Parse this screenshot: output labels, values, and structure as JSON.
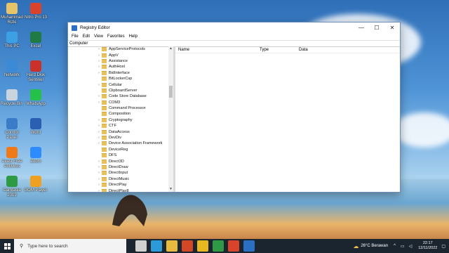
{
  "desktop_icons": [
    {
      "label": "Muhammad Rizki",
      "name": "user-folder-icon",
      "color": "#e6c46a"
    },
    {
      "label": "Nitro Pro 13",
      "name": "nitro-pro-icon",
      "color": "#d9432b"
    },
    {
      "label": "This PC",
      "name": "this-pc-icon",
      "color": "#3ea0e4"
    },
    {
      "label": "Excel",
      "name": "excel-icon",
      "color": "#1f7a43"
    },
    {
      "label": "Network",
      "name": "network-icon",
      "color": "#3a8ad6"
    },
    {
      "label": "Hard Disk Sentinel",
      "name": "hard-disk-sentinel-icon",
      "color": "#c9322a"
    },
    {
      "label": "Recycle Bin",
      "name": "recycle-bin-icon",
      "color": "#c8d4de"
    },
    {
      "label": "WhatsApp",
      "name": "whatsapp-icon",
      "color": "#25c04a"
    },
    {
      "label": "Control Panel",
      "name": "control-panel-icon",
      "color": "#3a7cc8"
    },
    {
      "label": "Word",
      "name": "word-icon",
      "color": "#2b5fb2"
    },
    {
      "label": "Avast Free Antivirus",
      "name": "avast-icon",
      "color": "#f07a1a"
    },
    {
      "label": "Zoom",
      "name": "zoom-icon",
      "color": "#2d8cff"
    },
    {
      "label": "Camtasia 2019",
      "name": "camtasia-icon",
      "color": "#2f9a45"
    },
    {
      "label": "GOM Player",
      "name": "gom-player-icon",
      "color": "#f0a020"
    }
  ],
  "window": {
    "title": "Registry Editor",
    "minimize": "—",
    "maximize": "☐",
    "close": "✕",
    "menu": [
      "File",
      "Edit",
      "View",
      "Favorites",
      "Help"
    ],
    "address": "Computer"
  },
  "tree": {
    "items": [
      "AppServiceProtocols",
      "AppV",
      "Assistance",
      "AuthHost",
      "BidInterface",
      "BitLockerCsp",
      "Cellular",
      "ClipboardServer",
      "Code Store Database",
      "COM3",
      "Command Processor",
      "Composition",
      "Cryptography",
      "CTF",
      "DataAccess",
      "DevDiv",
      "Device Association Framework",
      "DeviceReg",
      "DFS",
      "Direct3D",
      "DirectDraw",
      "DirectInput",
      "DirectMusic",
      "DirectPlay",
      "DirectPlay8"
    ],
    "has_arrow": [
      true,
      true,
      true,
      true,
      true,
      false,
      true,
      false,
      true,
      true,
      false,
      false,
      true,
      true,
      true,
      true,
      true,
      false,
      false,
      true,
      true,
      true,
      true,
      true,
      true
    ]
  },
  "values_pane": {
    "columns": [
      "Name",
      "Type",
      "Data"
    ]
  },
  "taskbar": {
    "search_placeholder": "Type here to search",
    "weather": "26°C  Berawan",
    "time": "22:17",
    "date": "12/11/2022",
    "apps": [
      {
        "name": "task-view-icon",
        "color": "#d0d0d0"
      },
      {
        "name": "edge-icon",
        "color": "#2c9ad8"
      },
      {
        "name": "file-explorer-icon",
        "color": "#e7b93f"
      },
      {
        "name": "powerpoint-icon",
        "color": "#d24726"
      },
      {
        "name": "chrome-icon",
        "color": "#e9b820"
      },
      {
        "name": "camtasia-taskbar-icon",
        "color": "#2f9a45"
      },
      {
        "name": "nitro-taskbar-icon",
        "color": "#d9432b"
      },
      {
        "name": "regedit-taskbar-icon",
        "color": "#2b6fc4"
      }
    ]
  }
}
